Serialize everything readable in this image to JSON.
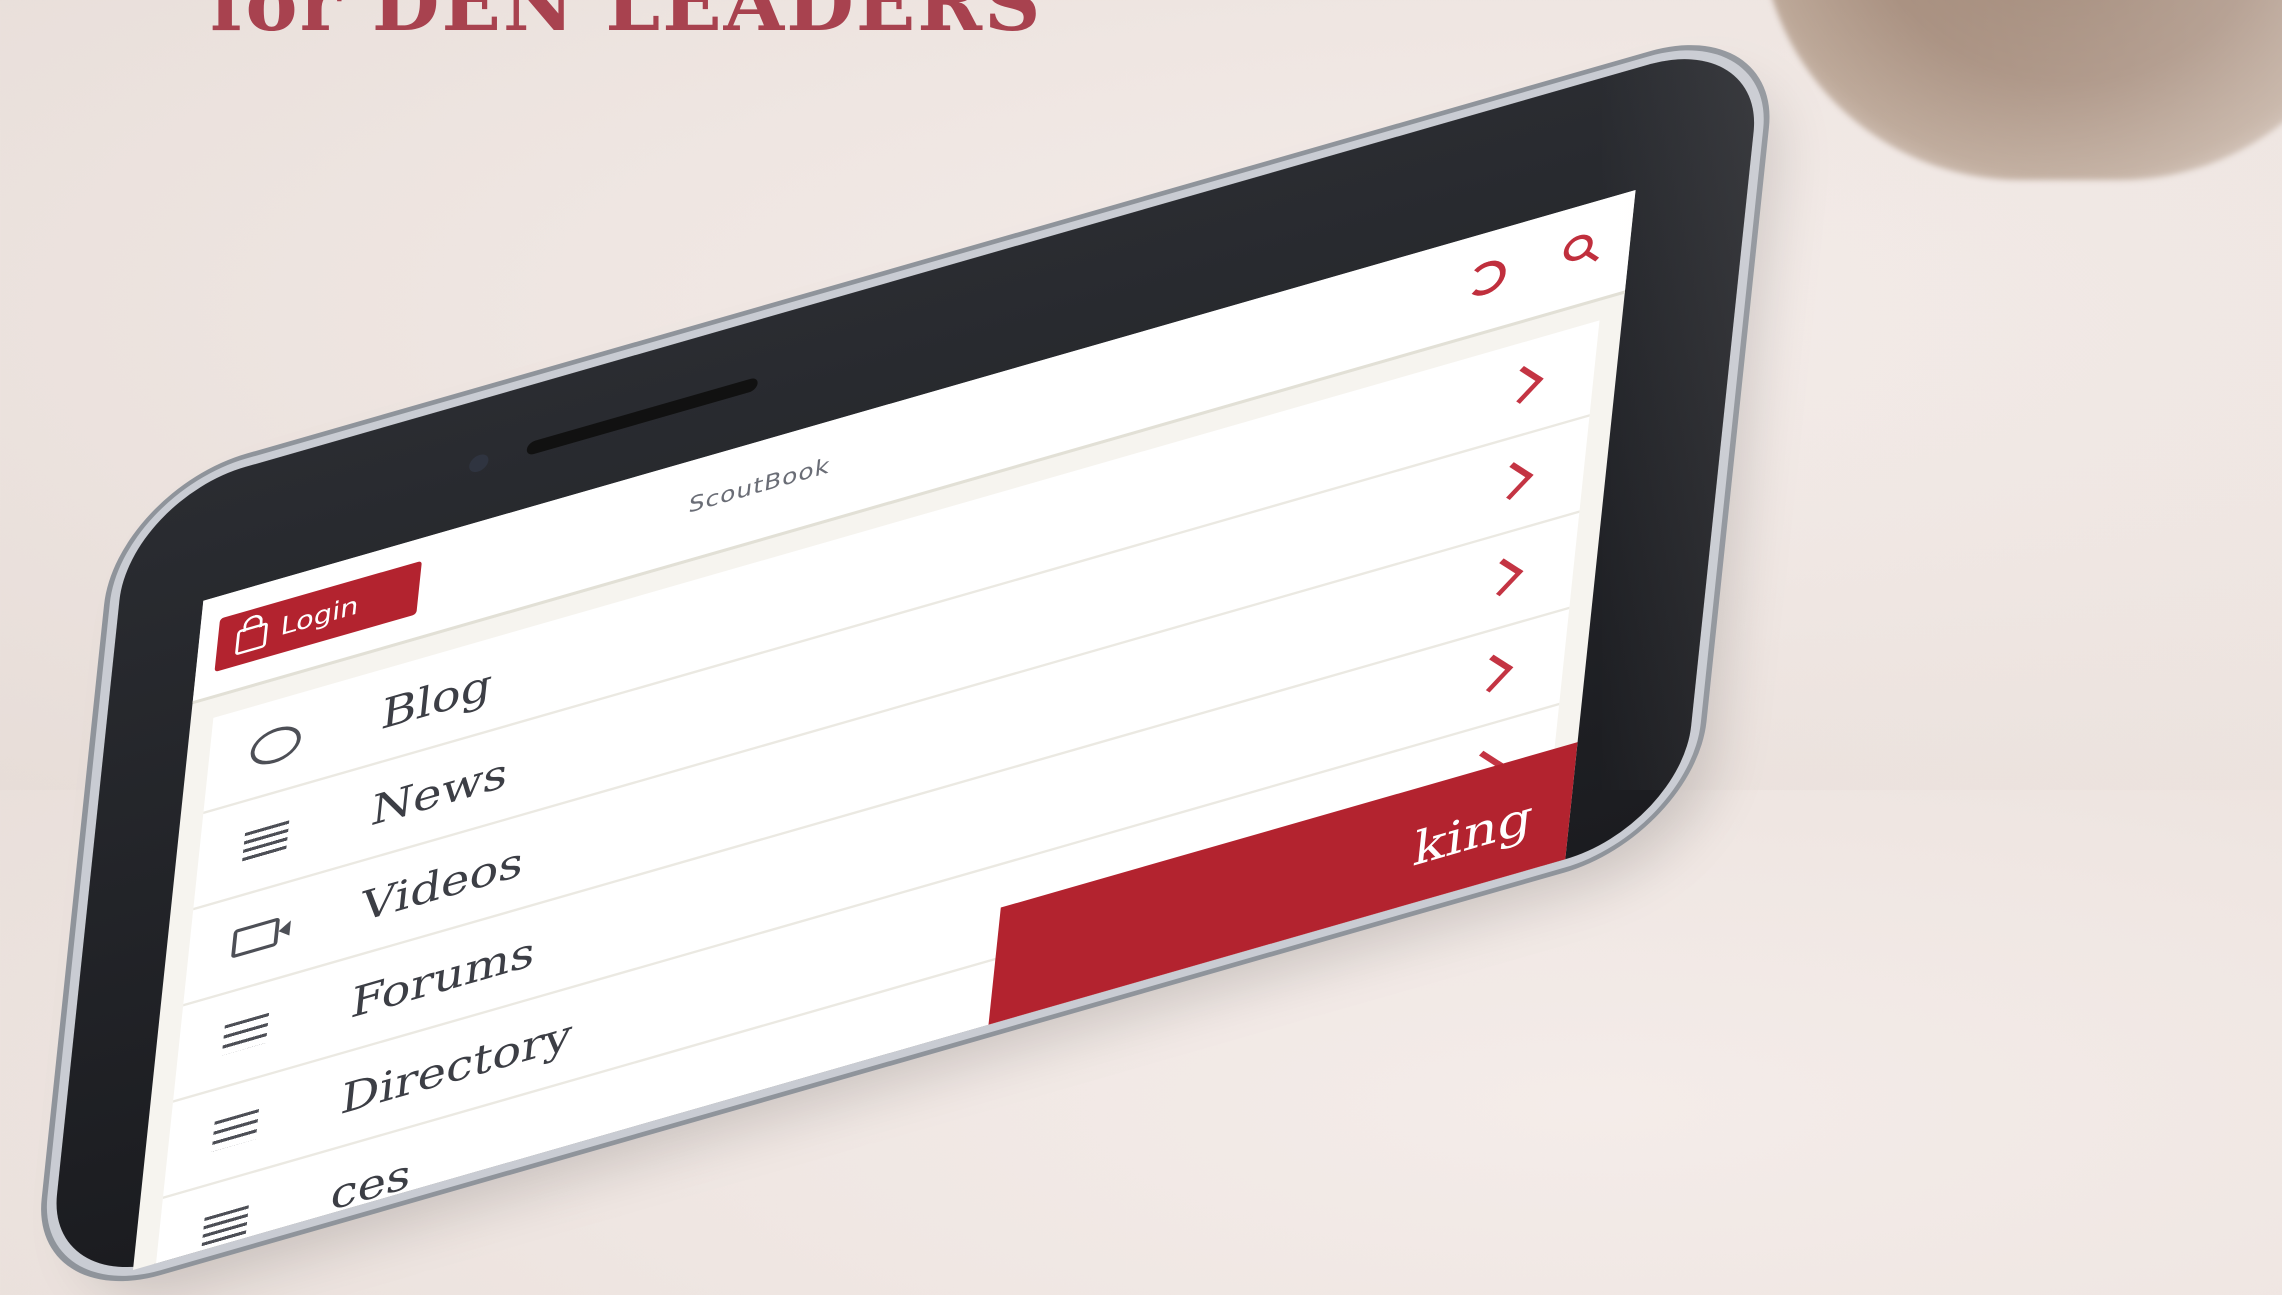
{
  "headline": "for DEN LEADERS",
  "app": {
    "title": "ScoutBook",
    "login_label": "Login",
    "menu": [
      {
        "label": "Blog",
        "icon": "chat-bubble-icon"
      },
      {
        "label": "News",
        "icon": "news-lines-icon"
      },
      {
        "label": "Videos",
        "icon": "video-camera-icon"
      },
      {
        "label": "Forums",
        "icon": "list-icon"
      },
      {
        "label": "Directory",
        "icon": "directory-icon"
      },
      {
        "label": "ces",
        "icon": "resources-icon"
      }
    ],
    "booking_label": "king"
  },
  "colors": {
    "brand_red": "#b3232f",
    "headline": "#a8424f"
  }
}
